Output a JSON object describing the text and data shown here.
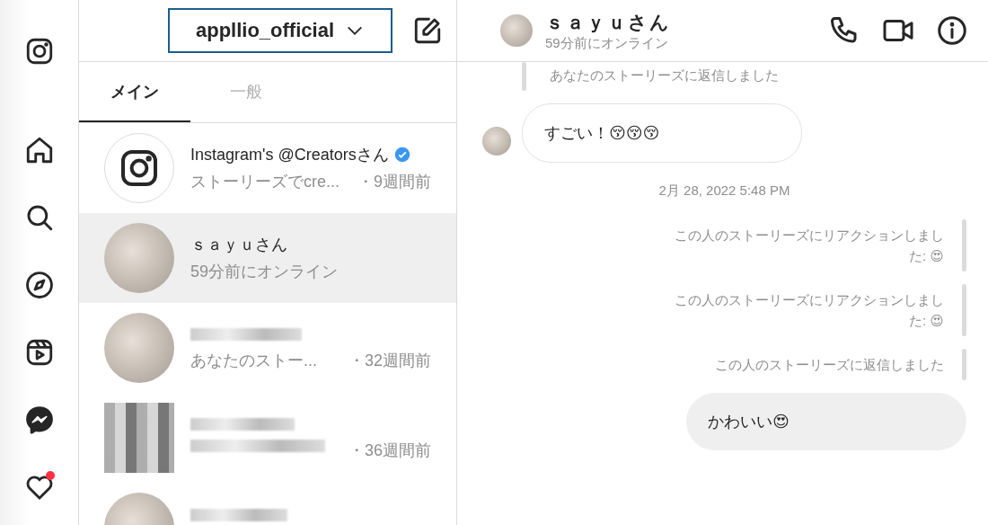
{
  "sidebar": {
    "activity_badge": true
  },
  "inbox": {
    "account": "appllio_official",
    "tabs": [
      {
        "label": "メイン",
        "selected": true
      },
      {
        "label": "一般",
        "selected": false
      }
    ],
    "threads": [
      {
        "kind": "logo",
        "name": "Instagram's @Creatorsさん",
        "verified": true,
        "preview": "ストーリーズでcre...",
        "time": "・9週間前",
        "selected": false
      },
      {
        "kind": "photo",
        "name": "ｓａｙｕさん",
        "verified": false,
        "preview": "59分前にオンライン",
        "selected": true
      },
      {
        "kind": "photo",
        "verified": false,
        "preview": "あなたのストー...",
        "time": "・32週間前",
        "selected": false
      },
      {
        "kind": "pixelated",
        "verified": false,
        "time": "・36週間前",
        "selected": false
      },
      {
        "kind": "photo",
        "verified": false,
        "selected": false
      }
    ]
  },
  "chat": {
    "name": "ｓａｙｕさん",
    "status": "59分前にオンライン",
    "messages": [
      {
        "kind": "story_note",
        "outgoing": false,
        "text": "あなたのストーリーズに返信しました"
      },
      {
        "kind": "bubble",
        "outgoing": false,
        "text": "すごい！😚😚😚"
      },
      {
        "kind": "timestamp",
        "text": "2月 28, 2022 5:48 PM"
      },
      {
        "kind": "story_note",
        "outgoing": true,
        "text": "この人のストーリーズにリアクションしました: 😍"
      },
      {
        "kind": "story_note",
        "outgoing": true,
        "text": "この人のストーリーズにリアクションしました: 😍"
      },
      {
        "kind": "story_note",
        "outgoing": true,
        "text": "この人のストーリーズに返信しました"
      },
      {
        "kind": "bubble",
        "outgoing": true,
        "text": "かわいい😍"
      }
    ]
  }
}
